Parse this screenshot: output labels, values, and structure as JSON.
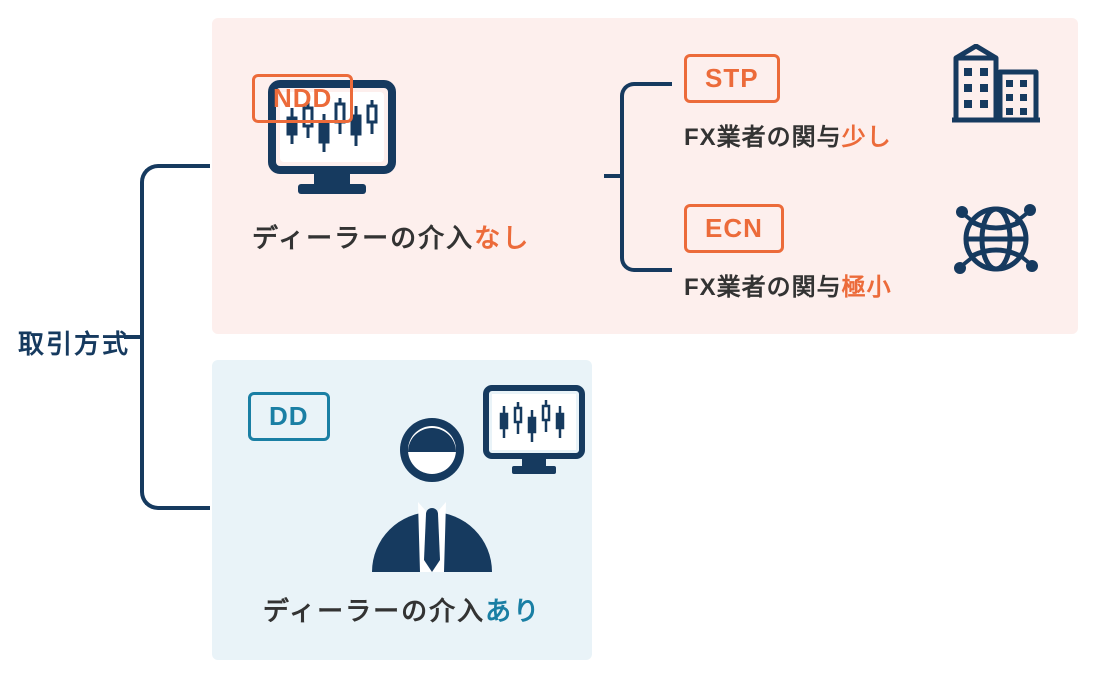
{
  "root_label": "取引方式",
  "ndd": {
    "tag": "NDD",
    "caption_prefix": "ディーラーの介入",
    "caption_highlight": "なし",
    "subs": {
      "stp": {
        "tag": "STP",
        "caption_prefix": "FX業者の関与",
        "caption_highlight": "少し"
      },
      "ecn": {
        "tag": "ECN",
        "caption_prefix": "FX業者の関与",
        "caption_highlight": "極小"
      }
    }
  },
  "dd": {
    "tag": "DD",
    "caption_prefix": "ディーラーの介入",
    "caption_highlight": "あり"
  },
  "colors": {
    "navy": "#163a5f",
    "orange": "#ec6b3a",
    "teal": "#1a7fa4",
    "pink_bg": "#fdefed",
    "blue_bg": "#e9f3f8"
  }
}
